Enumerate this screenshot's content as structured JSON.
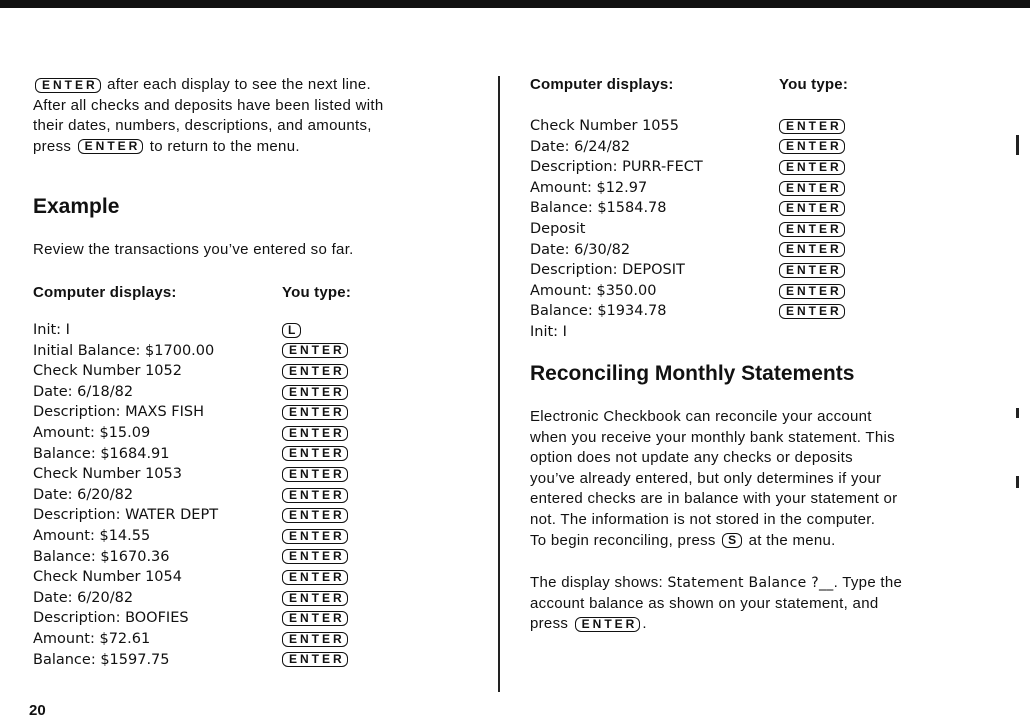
{
  "left": {
    "intro": {
      "line1_after_key": " after each display to see the next line.",
      "line2": "After all checks and deposits have been listed with",
      "line3": "their dates, numbers, descriptions, and amounts,",
      "line4_before_key": "press ",
      "line4_after_key": " to return to the menu."
    },
    "example_heading": "Example",
    "review_text": "Review the transactions you’ve entered so far.",
    "col_display_heading": "Computer displays:",
    "col_type_heading": "You type:",
    "display_lines": [
      "Init: I",
      "Initial Balance: $1700.00",
      "Check Number 1052",
      "Date: 6/18/82",
      "Description: MAXS FISH",
      "Amount: $15.09",
      "Balance: $1684.91",
      "Check Number 1053",
      "Date: 6/20/82",
      "Description: WATER DEPT",
      "Amount: $14.55",
      "Balance: $1670.36",
      "Check Number 1054",
      "Date: 6/20/82",
      "Description: BOOFIES",
      "Amount: $72.61",
      "Balance: $1597.75"
    ],
    "typed_keys": [
      "L",
      "ENTER",
      "ENTER",
      "ENTER",
      "ENTER",
      "ENTER",
      "ENTER",
      "ENTER",
      "ENTER",
      "ENTER",
      "ENTER",
      "ENTER",
      "ENTER",
      "ENTER",
      "ENTER",
      "ENTER",
      "ENTER"
    ]
  },
  "right": {
    "col_display_heading": "Computer displays:",
    "col_type_heading": "You type:",
    "display_lines": [
      "Check Number 1055",
      "Date: 6/24/82",
      "Description: PURR-FECT",
      "Amount: $12.97",
      "Balance: $1584.78",
      "Deposit",
      "Date: 6/30/82",
      "Description: DEPOSIT",
      "Amount: $350.00",
      "Balance: $1934.78",
      "Init: I"
    ],
    "typed_keys": [
      "ENTER",
      "ENTER",
      "ENTER",
      "ENTER",
      "ENTER",
      "ENTER",
      "ENTER",
      "ENTER",
      "ENTER",
      "ENTER"
    ],
    "section_heading": "Reconciling Monthly Statements",
    "reconcile": {
      "line1": "Electronic Checkbook can reconcile your account",
      "line2": "when you receive your monthly bank statement. This",
      "line3": "option does not update any checks or deposits",
      "line4": "you’ve already entered, but only determines if your",
      "line5": "entered checks are in balance with your statement or",
      "line6": "not. The information is not stored in the computer.",
      "line7_before_key": "To begin reconciling, press ",
      "line7_key": "S",
      "line7_after_key": " at the menu."
    },
    "display_shows": {
      "line1_prefix": "The display shows: ",
      "line1_prompt": "Statement Balance ?__",
      "line1_suffix": ". Type the",
      "line2": "account balance as shown on your statement, and",
      "line3_before_key": "press ",
      "line3_after_key": "."
    }
  },
  "enter_key_label": "ENTER",
  "page_number": "20"
}
